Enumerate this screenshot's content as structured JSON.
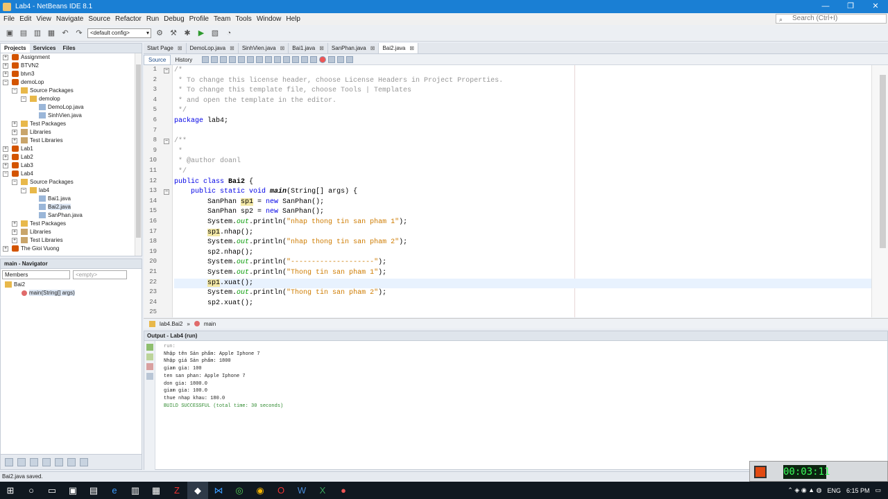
{
  "window": {
    "title": "Lab4 - NetBeans IDE 8.1",
    "minimize": "—",
    "maximize": "❐",
    "close": "✕"
  },
  "menu": [
    "File",
    "Edit",
    "View",
    "Navigate",
    "Source",
    "Refactor",
    "Run",
    "Debug",
    "Profile",
    "Team",
    "Tools",
    "Window",
    "Help"
  ],
  "search": {
    "placeholder": "Search (Ctrl+I)"
  },
  "toolbar": {
    "config": "<default config>"
  },
  "left_panel": {
    "tabs": [
      "Projects",
      "Services",
      "Files"
    ],
    "tree": [
      {
        "label": "Assignment",
        "depth": 0,
        "icon": "proj"
      },
      {
        "label": "BTVN2",
        "depth": 0,
        "icon": "proj"
      },
      {
        "label": "btvn3",
        "depth": 0,
        "icon": "proj"
      },
      {
        "label": "demoLop",
        "depth": 0,
        "icon": "proj",
        "open": true
      },
      {
        "label": "Source Packages",
        "depth": 1,
        "icon": "pkg",
        "open": true
      },
      {
        "label": "demolop",
        "depth": 2,
        "icon": "pkg",
        "open": true
      },
      {
        "label": "DemoLop.java",
        "depth": 3,
        "icon": "java"
      },
      {
        "label": "SinhVien.java",
        "depth": 3,
        "icon": "java"
      },
      {
        "label": "Test Packages",
        "depth": 1,
        "icon": "pkg"
      },
      {
        "label": "Libraries",
        "depth": 1,
        "icon": "lib"
      },
      {
        "label": "Test Libraries",
        "depth": 1,
        "icon": "lib"
      },
      {
        "label": "Lab1",
        "depth": 0,
        "icon": "proj"
      },
      {
        "label": "Lab2",
        "depth": 0,
        "icon": "proj"
      },
      {
        "label": "Lab3",
        "depth": 0,
        "icon": "proj"
      },
      {
        "label": "Lab4",
        "depth": 0,
        "icon": "proj",
        "open": true
      },
      {
        "label": "Source Packages",
        "depth": 1,
        "icon": "pkg",
        "open": true
      },
      {
        "label": "lab4",
        "depth": 2,
        "icon": "pkg",
        "open": true
      },
      {
        "label": "Bai1.java",
        "depth": 3,
        "icon": "java"
      },
      {
        "label": "Bai2.java",
        "depth": 3,
        "icon": "java",
        "selected": true
      },
      {
        "label": "SanPhan.java",
        "depth": 3,
        "icon": "java"
      },
      {
        "label": "Test Packages",
        "depth": 1,
        "icon": "pkg"
      },
      {
        "label": "Libraries",
        "depth": 1,
        "icon": "lib"
      },
      {
        "label": "Test Libraries",
        "depth": 1,
        "icon": "lib"
      },
      {
        "label": "The Gioi Vuong",
        "depth": 0,
        "icon": "proj"
      }
    ]
  },
  "navigator": {
    "title": "main - Navigator",
    "members": "Members",
    "filter": "<empty>",
    "class": "Bai2",
    "method": "main(String[] args)"
  },
  "editor_tabs": [
    {
      "label": "Start Page",
      "active": false
    },
    {
      "label": "DemoLop.java",
      "active": false
    },
    {
      "label": "SinhVien.java",
      "active": false
    },
    {
      "label": "Bai1.java",
      "active": false
    },
    {
      "label": "SanPhan.java",
      "active": false
    },
    {
      "label": "Bai2.java",
      "active": true
    }
  ],
  "editor": {
    "source": "Source",
    "history": "History",
    "lines": [
      [
        [
          "/*",
          "cm"
        ]
      ],
      [
        [
          " * To change this license header, choose License Headers in Project Properties.",
          "cm"
        ]
      ],
      [
        [
          " * To change this template file, choose Tools | Templates",
          "cm"
        ]
      ],
      [
        [
          " * and open the template in the editor.",
          "cm"
        ]
      ],
      [
        [
          " */",
          "cm"
        ]
      ],
      [
        [
          "package",
          "kw"
        ],
        [
          " lab4;",
          ""
        ]
      ],
      [],
      [
        [
          "/**",
          "cm"
        ]
      ],
      [
        [
          " *",
          "cm"
        ]
      ],
      [
        [
          " * @author doanl",
          "cm"
        ]
      ],
      [
        [
          " */",
          "cm"
        ]
      ],
      [
        [
          "public class ",
          "kw"
        ],
        [
          "Bai2",
          "bold"
        ],
        [
          " {",
          ""
        ]
      ],
      [
        [
          "    ",
          ""
        ],
        [
          "public static void ",
          "kw"
        ],
        [
          "main",
          "bold it"
        ],
        [
          "(String[] args) {",
          ""
        ]
      ],
      [
        [
          "        SanPhan ",
          ""
        ],
        [
          "sp1",
          "hl"
        ],
        [
          " = ",
          ""
        ],
        [
          "new",
          "kw"
        ],
        [
          " SanPhan();",
          ""
        ]
      ],
      [
        [
          "        SanPhan sp2 = ",
          ""
        ],
        [
          "new",
          "kw"
        ],
        [
          " SanPhan();",
          ""
        ]
      ],
      [
        [
          "        System.",
          ""
        ],
        [
          "out",
          "fld"
        ],
        [
          ".println(",
          ""
        ],
        [
          "\"nhap thong tin san pham 1\"",
          "str"
        ],
        [
          ");",
          ""
        ]
      ],
      [
        [
          "        ",
          ""
        ],
        [
          "sp1",
          "hl"
        ],
        [
          ".nhap();",
          ""
        ]
      ],
      [
        [
          "        System.",
          ""
        ],
        [
          "out",
          "fld"
        ],
        [
          ".println(",
          ""
        ],
        [
          "\"nhap thong tin san pham 2\"",
          "str"
        ],
        [
          ");",
          ""
        ]
      ],
      [
        [
          "        sp2.nhap();",
          ""
        ]
      ],
      [
        [
          "        System.",
          ""
        ],
        [
          "out",
          "fld"
        ],
        [
          ".println(",
          ""
        ],
        [
          "\"--------------------\"",
          "str"
        ],
        [
          ");",
          ""
        ]
      ],
      [
        [
          "        System.",
          ""
        ],
        [
          "out",
          "fld"
        ],
        [
          ".println(",
          ""
        ],
        [
          "\"Thong tin san pham 1\"",
          "str"
        ],
        [
          ");",
          ""
        ]
      ],
      [
        [
          "        ",
          ""
        ],
        [
          "sp1",
          "hl"
        ],
        [
          ".xuat();",
          ""
        ]
      ],
      [
        [
          "        System.",
          ""
        ],
        [
          "out",
          "fld"
        ],
        [
          ".println(",
          ""
        ],
        [
          "\"Thong tin san pham 2\"",
          "str"
        ],
        [
          ");",
          ""
        ]
      ],
      [
        [
          "        sp2.xuat();",
          ""
        ]
      ],
      []
    ],
    "current_line": 22
  },
  "breadcrumb": {
    "cls": "lab4.Bai2",
    "method": "main"
  },
  "output": {
    "title": "Output - Lab4 (run)",
    "lines": [
      [
        "run:",
        "dim"
      ],
      [
        "Nhập tên Sản phẩm: Apple Iphone 7",
        ""
      ],
      [
        "Nhập giá Sản phẩm: 1800",
        ""
      ],
      [
        "giam gia: 100",
        ""
      ],
      [
        "ten san phan: Apple Iphone 7",
        ""
      ],
      [
        "don gia: 1800.0",
        ""
      ],
      [
        "giam gia: 100.0",
        ""
      ],
      [
        "thue nhap khau: 180.0",
        ""
      ],
      [
        "BUILD SUCCESSFUL (total time: 30 seconds)",
        "ok"
      ]
    ]
  },
  "status": "Bai2.java saved.",
  "recorder": {
    "time": "00:03:11"
  },
  "taskbar": {
    "lang": "ENG",
    "time": "6:15 PM"
  },
  "colors": {
    "titlebar": "#1a7fd4",
    "keyword": "#0000e6",
    "string": "#ce7b00",
    "comment": "#969696"
  }
}
